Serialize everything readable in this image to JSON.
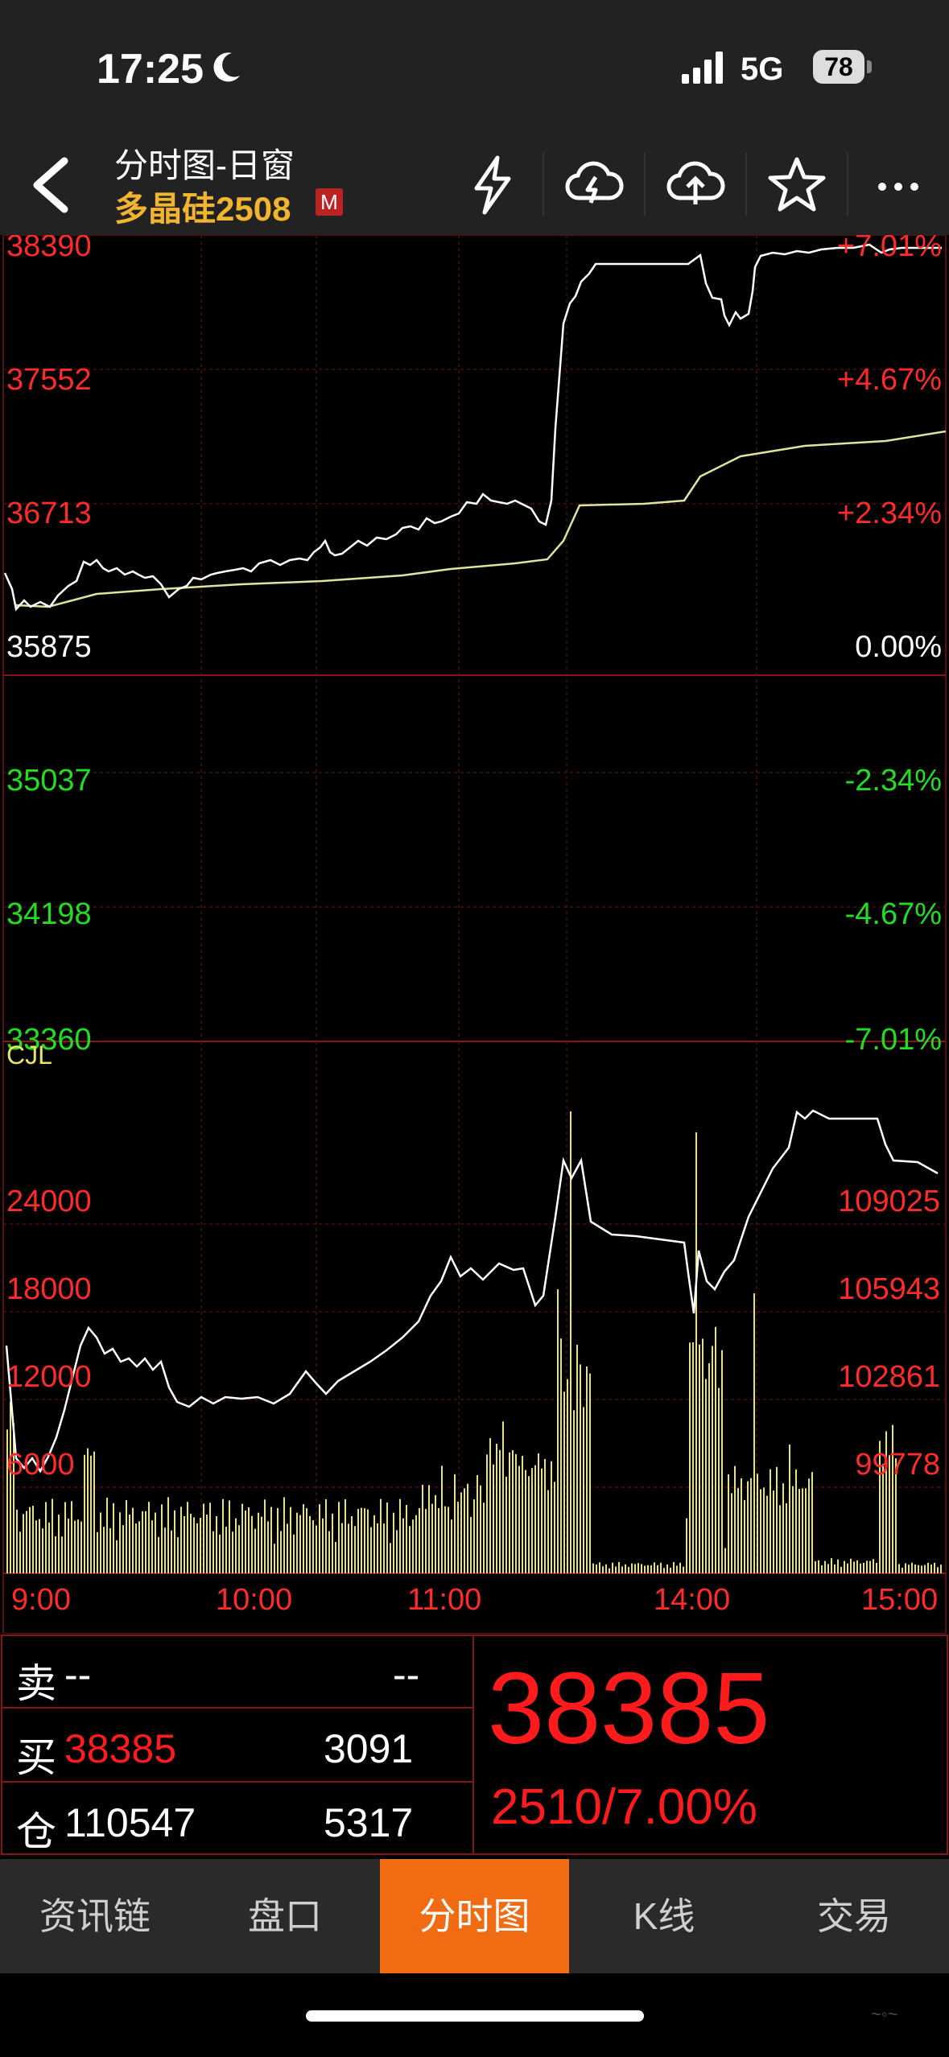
{
  "status": {
    "time": "17:25",
    "network": "5G",
    "battery": "78"
  },
  "header": {
    "title": "分时图-日窗",
    "symbol": "多晶硅2508",
    "badge": "M"
  },
  "price_chart": {
    "left_labels": [
      "38390",
      "37552",
      "36713",
      "35875",
      "35037",
      "34198",
      "33360"
    ],
    "right_labels": [
      "+7.01%",
      "+4.67%",
      "+2.34%",
      "0.00%",
      "-2.34%",
      "-4.67%",
      "-7.01%"
    ],
    "up_color": "#ff2a2a",
    "down_color": "#22dd22",
    "base_color": "#ffffff"
  },
  "volume_chart": {
    "indicator": "CJL",
    "left_labels": [
      "24000",
      "18000",
      "12000",
      "6000"
    ],
    "right_labels": [
      "109025",
      "105943",
      "102861",
      "99778"
    ],
    "time_labels": [
      "9:00",
      "10:00",
      "11:00",
      "14:00",
      "15:00"
    ]
  },
  "chart_data": [
    {
      "type": "line",
      "title": "",
      "x": [
        "9:00",
        "10:00",
        "11:00",
        "14:00",
        "15:00"
      ],
      "series": [],
      "ylim": [
        33360,
        38390
      ]
    },
    {
      "type": "bar",
      "title": "CJL",
      "categories": [],
      "values": [],
      "ylim": [
        0,
        24000
      ],
      "y2lim": [
        99778,
        109025
      ]
    }
  ],
  "order_panel": {
    "sell_label": "卖",
    "sell_price": "--",
    "sell_qty": "--",
    "buy_label": "买",
    "buy_price": "38385",
    "buy_qty": "3091",
    "oi_label": "仓",
    "oi_value": "110547",
    "oi_change": "5317",
    "last_price": "38385",
    "change": "2510/7.00%"
  },
  "tabs": [
    "资讯链",
    "盘口",
    "分时图",
    "K线",
    "交易"
  ],
  "active_tab": 2
}
